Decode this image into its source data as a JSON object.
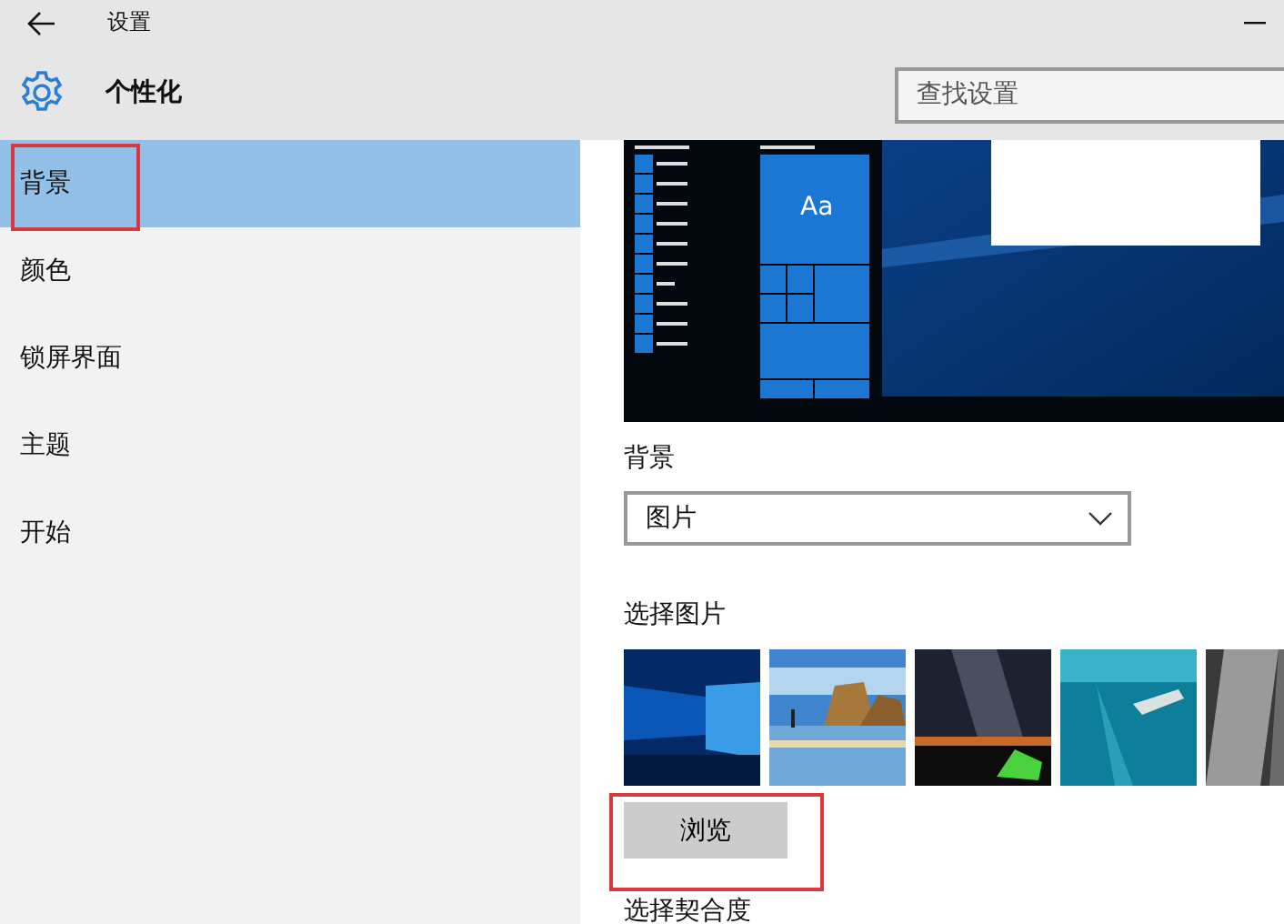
{
  "window": {
    "title": "设置"
  },
  "header": {
    "title": "个性化",
    "search": {
      "placeholder": "查找设置"
    }
  },
  "sidebar": {
    "items": [
      {
        "label": "背景",
        "selected": true,
        "highlighted": true
      },
      {
        "label": "颜色",
        "selected": false,
        "highlighted": false
      },
      {
        "label": "锁屏界面",
        "selected": false,
        "highlighted": false
      },
      {
        "label": "主题",
        "selected": false,
        "highlighted": false
      },
      {
        "label": "开始",
        "selected": false,
        "highlighted": false
      }
    ]
  },
  "preview": {
    "tile_text": "Aa"
  },
  "background": {
    "label": "背景",
    "value": "图片"
  },
  "choose_picture": {
    "label": "选择图片"
  },
  "browse": {
    "label": "浏览",
    "highlighted": true
  },
  "fit_label": "选择契合度"
}
